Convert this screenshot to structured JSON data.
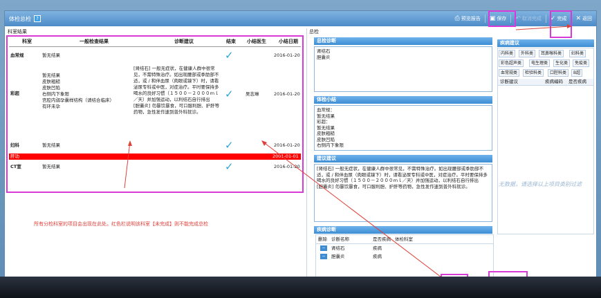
{
  "window": {
    "title": "体检总检"
  },
  "toolbar": {
    "print_label": "预览报告",
    "save_label": "保存",
    "cancel_label": "取消完成",
    "complete_label": "完成",
    "back_label": "返回"
  },
  "left": {
    "header": "科室结果",
    "columns": [
      "科室",
      "一般检查结果",
      "诊断建议",
      "结束",
      "小结医生",
      "小结日期"
    ],
    "rows": [
      {
        "dept": "血常规",
        "result": "暂无结果",
        "advice": "",
        "doctor": "",
        "date": "2016-01-20"
      },
      {
        "dept": "彩超",
        "result": "暂无结果\n皮肤粗糙\n皮肤凹陷\n右侧内下象限\n宫腔内弱孕囊样结构（请结合临床）\n有环未孕",
        "advice": "[肾结石] 一般无症状，在健康人群中很常见，不需特殊治疗。如出现腰部或季肋部不适，或 / 和伴血尿（肉眼或镜下）时，请看泌尿专科或中医，对症治疗。平时要保持多喝水的良好习惯（１５００－２０００ｍｌ／天）并加强运动，以利结石自行排出\n[胆囊炎] 勿暴饮暴食，可口服利胆、护肝等药物，急性发作速到普外科就诊。",
        "doctor": "吴志琳",
        "date": "2016-01-20"
      },
      {
        "dept": "妇科",
        "result": "暂无结果",
        "advice": "",
        "doctor": "",
        "date": "2016-01-20"
      },
      {
        "dept": "肝功",
        "result": "",
        "advice": "",
        "doctor": "",
        "date": "2001-01-01"
      },
      {
        "dept": "CT室",
        "result": "暂无结果",
        "advice": "",
        "doctor": "",
        "date": "2016-01-20"
      }
    ],
    "annotation": "所有分检科室的项目会出现在此处。红色栏说明该科室【未完成】则不能完成总检"
  },
  "right": {
    "header": "总检",
    "total_diag_title": "总检诊断",
    "total_diag_text": "肾结石\n胆囊炎",
    "summary_title": "体检小结",
    "summary_text": "血常规：\n暂无结果\n彩超：\n暂无结果\n皮肤粗糙\n皮肤凹陷\n右侧内下象限",
    "advice_title": "建议建议",
    "advice_text": "[肾结石] 一般无症状，在健康人群中很常见，不需特殊治疗。如出现腰部或季肋部不适，或 / 和伴血尿（肉眼或镜下）时，请看泌尿专科或中医，对症治疗。平时要保持多喝水的良好习惯（１５００－２０００ｍｌ／天）并加强运动，以利结石自行排出\n[胆囊炎] 勿暴饮暴食，可口服利胆、护肝等药物，急性发作速到普外科就诊。",
    "disease_title": "疾病诊断",
    "disease_columns": [
      "删除",
      "诊断名称",
      "是否疾病",
      "体检科室"
    ],
    "disease_rows": [
      {
        "name": "肾结石",
        "is_disease": "疾病",
        "dept": ""
      },
      {
        "name": "胆囊炎",
        "is_disease": "疾病",
        "dept": ""
      }
    ],
    "category_title": "疾病建议",
    "categories": [
      "内科类",
      "外科类",
      "耳鼻喉科类",
      "妇科类",
      "彩色超声类",
      "电生理类",
      "生化类",
      "免疫类",
      "血常规类",
      "检验科类",
      "口腔科类",
      "B超"
    ],
    "cat_columns": [
      "诊断建议",
      "疾病编码",
      "是否疾病"
    ],
    "empty_message": "无数据，请选择以上项目类别过滤"
  },
  "colors": {
    "accent": "#3d8dd4",
    "highlight": "#d83ad8",
    "error": "#ff0000",
    "check": "#2aa6df"
  }
}
